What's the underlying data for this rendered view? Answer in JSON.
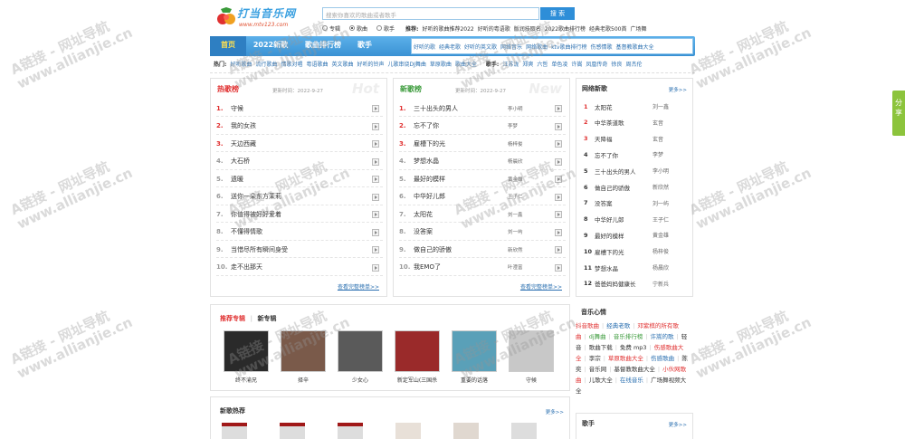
{
  "site": {
    "logo_text": "打当音乐网",
    "logo_url_text": "www.mtv123.com"
  },
  "search": {
    "placeholder": "搜索你喜欢的歌曲或者歌手",
    "button": "搜 索"
  },
  "radio": [
    {
      "label": "专辑",
      "checked": false
    },
    {
      "label": "歌曲",
      "checked": true
    },
    {
      "label": "歌手",
      "checked": false
    }
  ],
  "recommend": {
    "label": "推荐:",
    "links": [
      "好听的歌曲推荐2022",
      "好听的粤语歌",
      "版润技取名",
      "2022歌曲排行榜",
      "经典老歌500首",
      "广场舞"
    ]
  },
  "nav": [
    "首页",
    "2022新歌",
    "歌曲排行榜",
    "歌手"
  ],
  "nav_sub": [
    "好听的歌",
    "经典老歌",
    "好听的英文歌",
    "网络音乐",
    "网络歌曲",
    "ktv歌曲排行榜",
    "伤感情歌",
    "基督教歌曲大全"
  ],
  "hot": {
    "label": "热门:",
    "items": [
      "好听歌曲",
      "流行歌曲",
      "情歌对唱",
      "粤语歌曲",
      "英文歌曲",
      "好听的铃声",
      "儿歌串烧DJ舞曲",
      "草原歌曲",
      "歌曲大全"
    ],
    "singer_label": "歌手:",
    "singers": [
      "汪苏泷",
      "郑爽",
      "六哲",
      "单色凌",
      "许嵩",
      "凤凰传奇",
      "徐良",
      "周杰伦"
    ]
  },
  "hot_chart": {
    "title": "热歌榜",
    "updated": "更新时间：2022-9-27",
    "bg": "Hot",
    "items": [
      {
        "n": "1.",
        "name": "守候",
        "artist": ""
      },
      {
        "n": "2.",
        "name": "我的女孩",
        "artist": ""
      },
      {
        "n": "3.",
        "name": "天边西藏",
        "artist": ""
      },
      {
        "n": "4.",
        "name": "大石桥",
        "artist": ""
      },
      {
        "n": "5.",
        "name": "遗暖",
        "artist": ""
      },
      {
        "n": "6.",
        "name": "送你一朵东方茉莉",
        "artist": ""
      },
      {
        "n": "7.",
        "name": "你值得被好好爱着",
        "artist": ""
      },
      {
        "n": "8.",
        "name": "不懂得情歌",
        "artist": ""
      },
      {
        "n": "9.",
        "name": "当惜尽所有瞬间身受",
        "artist": ""
      },
      {
        "n": "10.",
        "name": "走不出那天",
        "artist": ""
      }
    ],
    "more": "查看完整榜单>>"
  },
  "new_chart": {
    "title": "新歌榜",
    "updated": "更新时间：2022-9-27",
    "bg": "New",
    "items": [
      {
        "n": "1.",
        "name": "三十出头的男人",
        "artist": "李小明"
      },
      {
        "n": "2.",
        "name": "忘不了你",
        "artist": "李梦"
      },
      {
        "n": "3.",
        "name": "雇槽下的光",
        "artist": "杨梓俊"
      },
      {
        "n": "4.",
        "name": "梦想水晶",
        "artist": "杨晨欣"
      },
      {
        "n": "5.",
        "name": "最好的模样",
        "artist": "黄金雄"
      },
      {
        "n": "6.",
        "name": "中华好儿郎",
        "artist": "王子仁"
      },
      {
        "n": "7.",
        "name": "太阳花",
        "artist": "刘一鑫"
      },
      {
        "n": "8.",
        "name": "没答案",
        "artist": "刘一屿"
      },
      {
        "n": "9.",
        "name": "做自己的骄傲",
        "artist": "新欣然"
      },
      {
        "n": "10.",
        "name": "我EMO了",
        "artist": "叶澄富"
      }
    ],
    "more": "查看完整榜单>>"
  },
  "net_songs": {
    "title": "网络新歌",
    "more": "更多>>",
    "items": [
      {
        "n": "1",
        "name": "太阳花",
        "artist": "刘一鑫"
      },
      {
        "n": "2",
        "name": "中华茶道歌",
        "artist": "玄音"
      },
      {
        "n": "3",
        "name": "天降福",
        "artist": "玄音"
      },
      {
        "n": "4",
        "name": "忘不了你",
        "artist": "李梦"
      },
      {
        "n": "5",
        "name": "三十出头的男人",
        "artist": "李小明"
      },
      {
        "n": "6",
        "name": "做自己的骄傲",
        "artist": "新欣然"
      },
      {
        "n": "7",
        "name": "没答案",
        "artist": "刘一屿"
      },
      {
        "n": "8",
        "name": "中华好儿郎",
        "artist": "王子仁"
      },
      {
        "n": "9",
        "name": "最好的模样",
        "artist": "黄金雄"
      },
      {
        "n": "10",
        "name": "雇槽下的光",
        "artist": "杨梓俊"
      },
      {
        "n": "11",
        "name": "梦想水晶",
        "artist": "杨晨欣"
      },
      {
        "n": "12",
        "name": "爸爸妈妈健康长",
        "artist": "宁新兵"
      }
    ]
  },
  "albums": {
    "tab_active": "推荐专辑",
    "tab_other": "新专辑",
    "items": [
      {
        "name": "终不渝兄",
        "color": "#2a2a2a"
      },
      {
        "name": "择辛",
        "color": "#7a5a4a"
      },
      {
        "name": "少女心",
        "color": "#5a5a5a"
      },
      {
        "name": "新定军山(三国杀",
        "color": "#9a2a2a"
      },
      {
        "name": "重要的话落",
        "color": "#5aa0b8"
      },
      {
        "name": "守候",
        "color": "#c8c8c8"
      }
    ]
  },
  "new_hot": {
    "title": "新歌热荐",
    "more": "更多>>"
  },
  "mood": {
    "title": "音乐心情",
    "tags": [
      {
        "t": "抖音歌曲",
        "c": "#e03030"
      },
      {
        "t": "经典老歌",
        "c": "#2a6fb0"
      },
      {
        "t": "邓紫棋的所有歌曲",
        "c": "#e03030"
      },
      {
        "t": "dj舞曲",
        "c": "#3a9a3a"
      },
      {
        "t": "音乐排行榜",
        "c": "#3a9a3a"
      },
      {
        "t": "许嵩的歌",
        "c": "#2a6fb0"
      },
      {
        "t": "轻音",
        "c": "#333333"
      },
      {
        "t": "歌曲下载",
        "c": "#333333"
      },
      {
        "t": "免费 mp3",
        "c": "#333333"
      },
      {
        "t": "伤感歌曲大全",
        "c": "#e03030"
      },
      {
        "t": "李宗",
        "c": "#333333"
      },
      {
        "t": "草原歌曲大全",
        "c": "#e03030"
      },
      {
        "t": "伤感歌曲",
        "c": "#2a6fb0"
      },
      {
        "t": "陈奕",
        "c": "#333333"
      },
      {
        "t": "音乐网",
        "c": "#333333"
      },
      {
        "t": "基督教歌曲大全",
        "c": "#333333"
      },
      {
        "t": "小伙网歌曲",
        "c": "#e03030"
      },
      {
        "t": "儿歌大全",
        "c": "#333333"
      },
      {
        "t": "在线音乐",
        "c": "#2a6fb0"
      },
      {
        "t": "广场舞视频大全",
        "c": "#333333"
      }
    ]
  },
  "singers_panel": {
    "title": "歌手",
    "more": "更多>>"
  },
  "watermark": {
    "line1": "A链接 - 网址导航",
    "line2": "www.allianjie.cn"
  },
  "share": "分享"
}
